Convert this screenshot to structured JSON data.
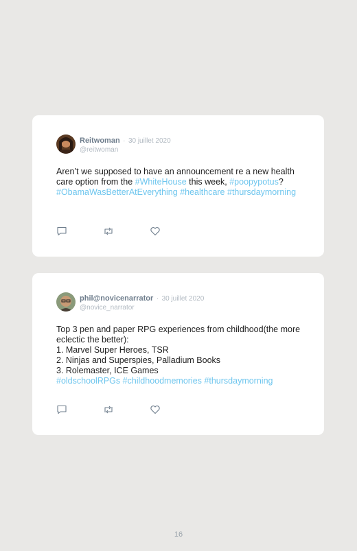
{
  "tweets": [
    {
      "author": "Reitwoman",
      "separator": "·",
      "date": "30 juillet 2020",
      "handle": "@reitwoman",
      "text_parts": [
        {
          "text": "Aren’t we supposed to have an announcement re a new health care option from the "
        },
        {
          "text": "#WhiteHouse",
          "tag": true
        },
        {
          "text": " this week, "
        },
        {
          "text": "#poopypotus",
          "tag": true
        },
        {
          "text": "? "
        },
        {
          "text": "#ObamaWasBetterAtEverything",
          "tag": true
        },
        {
          "text": " "
        },
        {
          "text": "#healthcare",
          "tag": true
        },
        {
          "text": " "
        },
        {
          "text": "#thursdaymorning",
          "tag": true
        }
      ]
    },
    {
      "author": "phil@novicenarrator",
      "separator": "·",
      "date": "30 juillet 2020",
      "handle": "@novice_narrator",
      "text_parts": [
        {
          "text": "Top 3 pen and paper RPG experiences from childhood(the more eclectic the better):\n1. Marvel Super Heroes, TSR\n2. Ninjas and Superspies, Palladium Books\n3. Rolemaster, ICE Games\n"
        },
        {
          "text": "#oldschoolRPGs",
          "tag": true
        },
        {
          "text": " "
        },
        {
          "text": "#childhoodmemories",
          "tag": true
        },
        {
          "text": " "
        },
        {
          "text": "#thursdaymorning",
          "tag": true
        }
      ]
    }
  ],
  "actions": [
    "reply-icon",
    "retweet-icon",
    "like-icon"
  ],
  "colors": {
    "hashtag": "#6fc6ee",
    "name": "#6e7d8c",
    "muted": "#b2bac2",
    "background": "#e9e8e6"
  },
  "page_number": "16"
}
